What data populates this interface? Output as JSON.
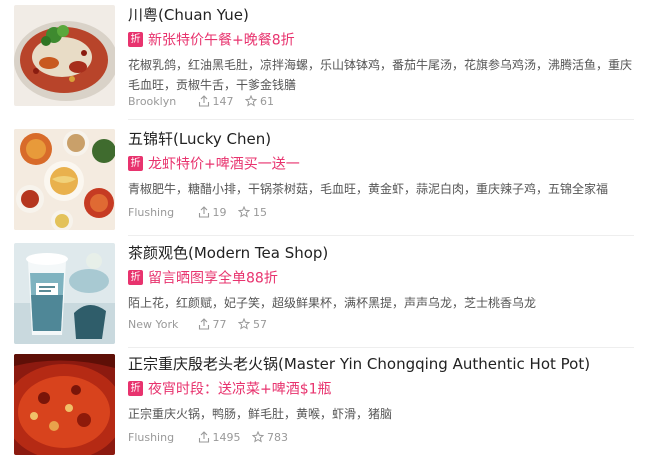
{
  "promo_badge": "折",
  "restaurants": [
    {
      "name": "川粤(Chuan Yue)",
      "promo": "新张特价午餐+晚餐8折",
      "dishes": "花椒乳鸽，红油黑毛肚，凉拌海螺，乐山钵钵鸡，番茄牛尾汤，花旗参乌鸡汤，沸腾活鱼，重庆毛血旺，贡椒牛舌，干爹金钱膳",
      "location": "Brooklyn",
      "shares": "147",
      "favorites": "61",
      "thumbnail": "spicy-fish-dish"
    },
    {
      "name": "五锦轩(Lucky Chen)",
      "promo": "龙虾特价+啤酒买一送一",
      "dishes": "青椒肥牛，糖醋小排，干锅茶树菇，毛血旺，黄金虾，蒜泥白肉，重庆辣子鸡，五锦全家福",
      "location": "Flushing",
      "shares": "19",
      "favorites": "15",
      "thumbnail": "table-spread-dishes"
    },
    {
      "name": "茶颜观色(Modern Tea Shop)",
      "promo": "留言晒图享全单88折",
      "dishes": "陌上花，红颜赋，妃子笑，超级鲜果杯，满杯黑提，声声乌龙，芝士桃香乌龙",
      "location": "New York",
      "shares": "77",
      "favorites": "57",
      "thumbnail": "tea-cup-drink"
    },
    {
      "name": "正宗重庆殷老头老火锅(Master Yin Chongqing Authentic Hot Pot)",
      "promo": "夜宵时段：送凉菜+啤酒$1瓶",
      "dishes": "正宗重庆火锅，鸭肠，鲜毛肚，黄喉，虾滑，猪脑",
      "location": "Flushing",
      "shares": "1495",
      "favorites": "783",
      "thumbnail": "red-hot-pot"
    }
  ],
  "colors": {
    "promo": "#e8336e",
    "meta": "#999999",
    "divider": "#eeeeee"
  },
  "icons": {
    "share": "share-icon",
    "favorite": "star-icon"
  }
}
